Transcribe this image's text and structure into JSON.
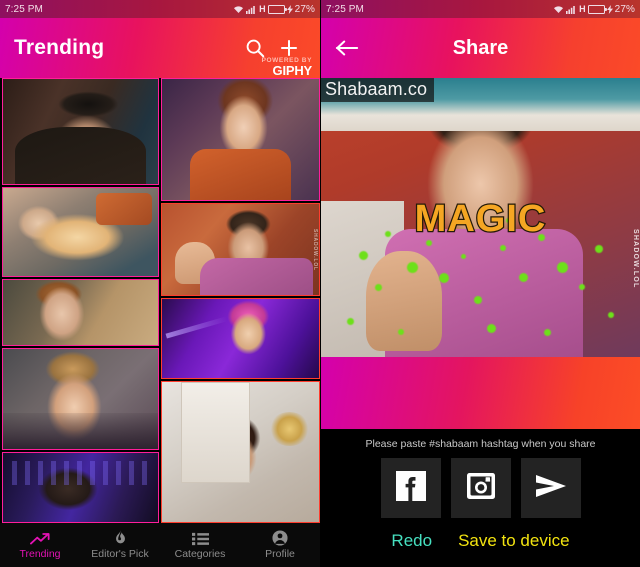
{
  "status_bar": {
    "time": "7:25 PM",
    "network_type": "H",
    "battery_percent": "27%",
    "icons": [
      "wifi-icon",
      "signal-icon",
      "battery-icon",
      "charging-bolt-icon"
    ]
  },
  "left_screen": {
    "app_bar": {
      "title": "Trending",
      "search_icon": "search-icon",
      "add_icon": "plus-icon",
      "powered_by_line1": "POWERED BY",
      "powered_by_line2": "GIPHY"
    },
    "grid": {
      "left_column": [
        {
          "name": "gif-tile-man-hat",
          "border": "#ff1e9a"
        },
        {
          "name": "gif-tile-cat-belly-rub",
          "border": "#ff1e9a"
        },
        {
          "name": "gif-tile-woman-gasp",
          "border": "#ff1e9a"
        },
        {
          "name": "gif-tile-woman-facepalm",
          "border": "#ff1e9a"
        },
        {
          "name": "gif-tile-man-dj-booth",
          "border": "#ff1e9a"
        }
      ],
      "right_column": [
        {
          "name": "gif-tile-redhead-shocked",
          "border": "#ff1e9a"
        },
        {
          "name": "gif-tile-man-raised-hand",
          "border": "#ff3d2e"
        },
        {
          "name": "gif-tile-drag-queen-purple",
          "border": "#ff3d2e"
        },
        {
          "name": "gif-tile-woman-hair-flip",
          "border": "#ff3d2e"
        }
      ]
    },
    "bottom_nav": [
      {
        "label": "Trending",
        "icon": "trending-up-icon",
        "active": true
      },
      {
        "label": "Editor's Pick",
        "icon": "flame-icon",
        "active": false
      },
      {
        "label": "Categories",
        "icon": "list-icon",
        "active": false
      },
      {
        "label": "Profile",
        "icon": "person-icon",
        "active": false
      }
    ],
    "colors": {
      "accent_active": "#e312b4",
      "nav_inactive": "#8d8d8d",
      "nav_background": "#0a0a0a"
    }
  },
  "right_screen": {
    "app_bar": {
      "title": "Share",
      "back_icon": "arrow-left-icon"
    },
    "preview": {
      "site_label": "Shabaam.co",
      "caption": "MAGIC",
      "watermark": "SHADOW.LOL",
      "caption_color": "#f5a623"
    },
    "share_panel": {
      "hint": "Please paste #shabaam hashtag when you share",
      "buttons": [
        {
          "name": "share-facebook-button",
          "icon": "facebook-icon"
        },
        {
          "name": "share-instagram-button",
          "icon": "instagram-icon"
        },
        {
          "name": "share-send-button",
          "icon": "send-icon"
        }
      ],
      "redo_label": "Redo",
      "save_label": "Save to device",
      "redo_color": "#46e0c0",
      "save_color": "#f2e310"
    }
  },
  "theme": {
    "gradient_start": "#d400ad",
    "gradient_mid": "#e8125e",
    "gradient_end": "#fb4a28",
    "status_bar_bg": "#a8173f"
  }
}
